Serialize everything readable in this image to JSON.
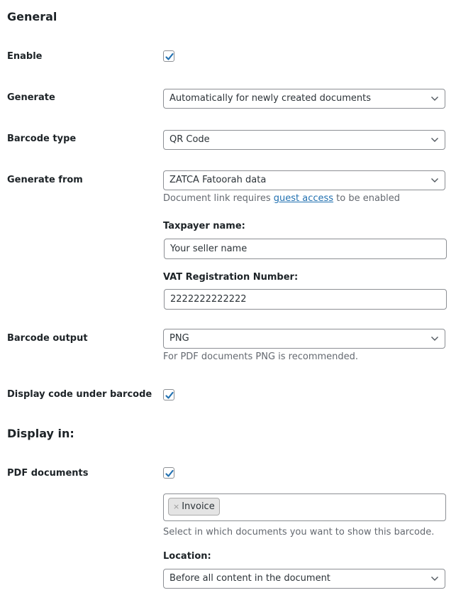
{
  "general": {
    "heading": "General",
    "enable": {
      "label": "Enable",
      "checked": true
    },
    "generate": {
      "label": "Generate",
      "value": "Automatically for newly created documents"
    },
    "barcode_type": {
      "label": "Barcode type",
      "value": "QR Code"
    },
    "generate_from": {
      "label": "Generate from",
      "value": "ZATCA Fatoorah data",
      "desc_before": "Document link requires ",
      "desc_link": "guest access",
      "desc_after": " to be enabled"
    },
    "taxpayer_name": {
      "label": "Taxpayer name:",
      "value": "Your seller name"
    },
    "vat_number": {
      "label": "VAT Registration Number:",
      "value": "2222222222222"
    },
    "barcode_output": {
      "label": "Barcode output",
      "value": "PNG",
      "desc": "For PDF documents PNG is recommended."
    },
    "display_code": {
      "label": "Display code under barcode",
      "checked": true
    }
  },
  "display_in": {
    "heading": "Display in:",
    "pdf_documents": {
      "label": "PDF documents",
      "checked": true,
      "selected_tags": [
        {
          "label": "Invoice",
          "remove": "×"
        }
      ],
      "desc": "Select in which documents you want to show this barcode.",
      "location_label": "Location:",
      "location_value": "Before all content in the document"
    }
  },
  "colors": {
    "accent": "#2271b1",
    "border": "#8c8f94",
    "text": "#1d2327",
    "muted": "#646970"
  }
}
